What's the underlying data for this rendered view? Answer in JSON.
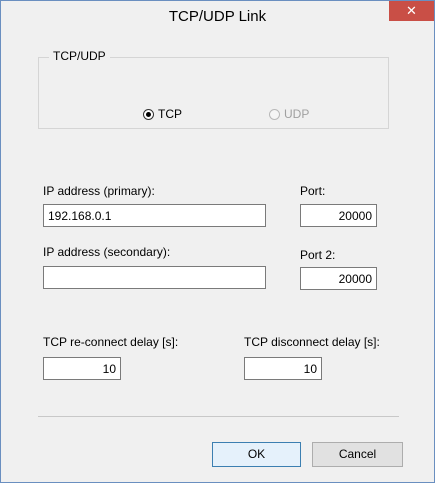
{
  "window": {
    "title": "TCP/UDP Link",
    "close_symbol": "✕"
  },
  "protocol": {
    "group_label": "TCP/UDP",
    "tcp_label": "TCP",
    "udp_label": "UDP",
    "selected": "TCP"
  },
  "ip_primary": {
    "label": "IP address (primary):",
    "value": "192.168.0.1"
  },
  "port": {
    "label": "Port:",
    "value": "20000"
  },
  "ip_secondary": {
    "label": "IP address (secondary):",
    "value": ""
  },
  "port2": {
    "label": "Port 2:",
    "value": "20000"
  },
  "reconnect_delay": {
    "label": "TCP re-connect delay [s]:",
    "value": "10"
  },
  "disconnect_delay": {
    "label": "TCP disconnect delay [s]:",
    "value": "10"
  },
  "buttons": {
    "ok": "OK",
    "cancel": "Cancel"
  }
}
